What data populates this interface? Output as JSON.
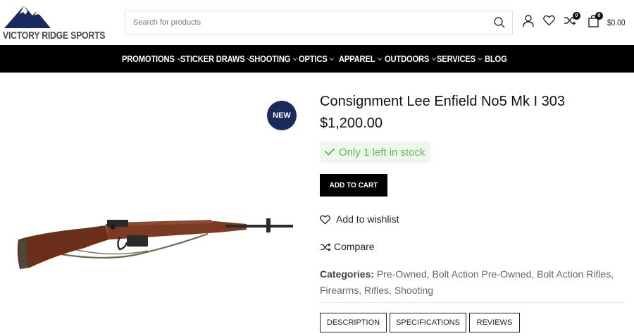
{
  "header": {
    "logo_text": "VICTORY RIDGE SPORTS",
    "search_placeholder": "Search for products",
    "compare_count": "0",
    "cart_count": "0",
    "cart_total": "$0.00"
  },
  "nav": {
    "items": [
      {
        "label": "PROMOTIONS",
        "has_dropdown": true
      },
      {
        "label": "STICKER DRAWS",
        "has_dropdown": true
      },
      {
        "label": "SHOOTING",
        "has_dropdown": true
      },
      {
        "label": "OPTICS",
        "has_dropdown": true
      },
      {
        "label": "APPAREL",
        "has_dropdown": true
      },
      {
        "label": "OUTDOORS",
        "has_dropdown": true
      },
      {
        "label": "SERVICES",
        "has_dropdown": true
      },
      {
        "label": "BLOG",
        "has_dropdown": false
      }
    ]
  },
  "product": {
    "badge": "NEW",
    "title": "Consignment Lee Enfield No5 Mk I 303",
    "price": "$1,200.00",
    "stock": "Only 1 left in stock",
    "add_to_cart": "ADD TO CART",
    "wishlist": "Add to wishlist",
    "compare": "Compare",
    "categories_label": "Categories:",
    "categories": [
      "Pre-Owned",
      "Bolt Action Pre-Owned",
      "Bolt Action Rifles",
      "Firearms",
      "Rifles",
      "Shooting"
    ]
  },
  "tabs": [
    "DESCRIPTION",
    "SPECIFICATIONS",
    "REVIEWS"
  ],
  "colors": {
    "nav_bg": "#000000",
    "badge_bg": "#1b2a5c",
    "stock_green": "#6fb35d",
    "stock_bg": "#edf7ec"
  }
}
